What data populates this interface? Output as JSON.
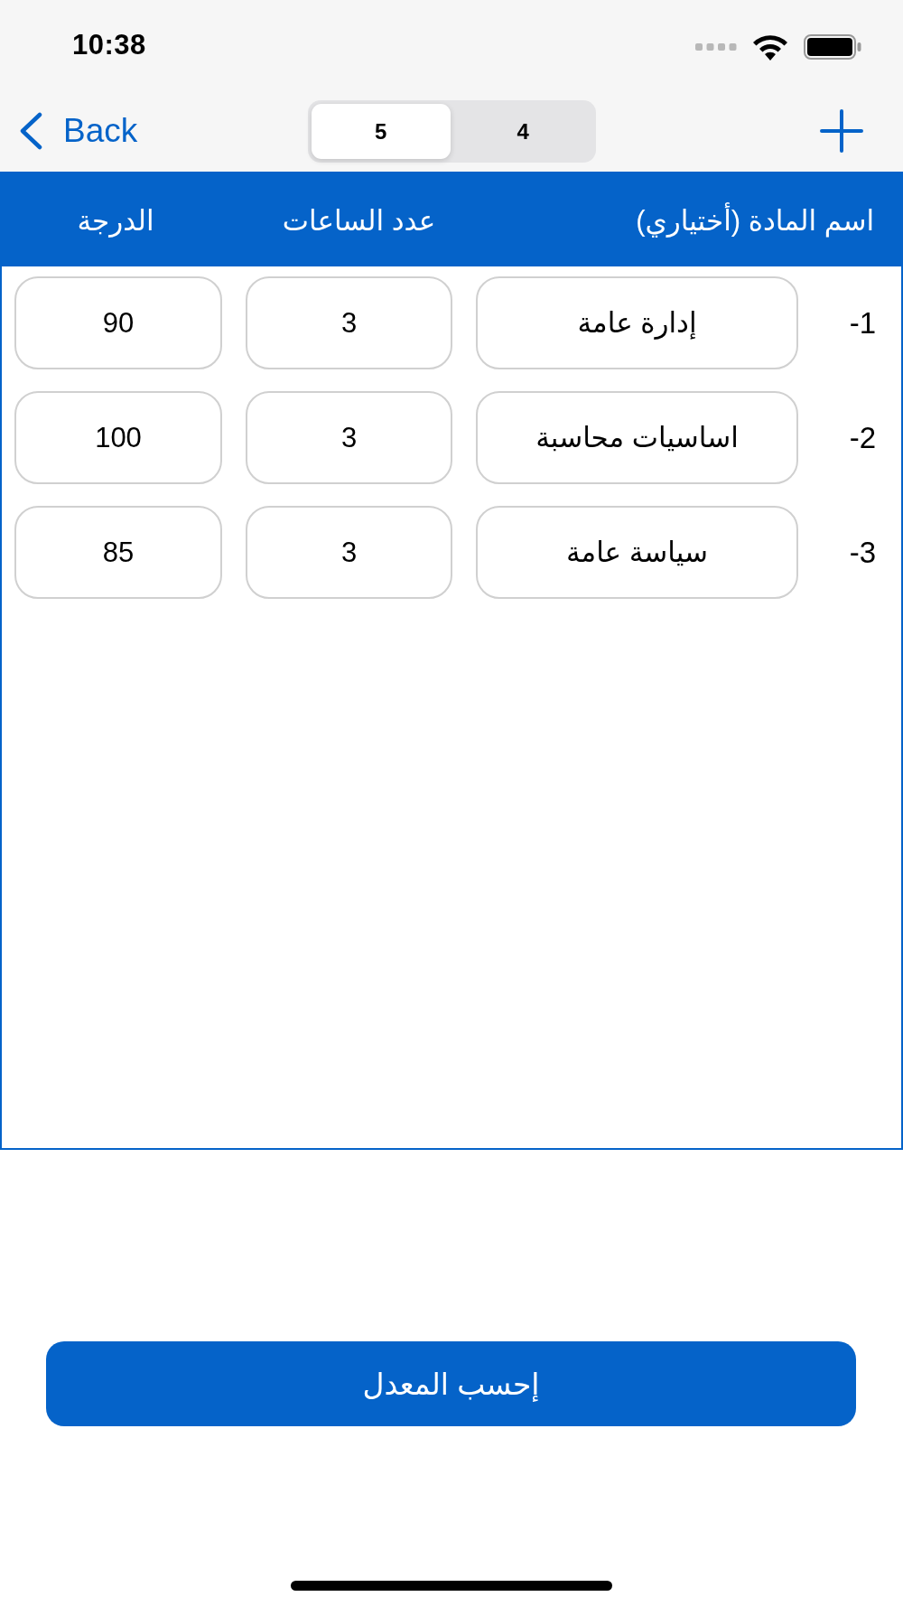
{
  "status_bar": {
    "time": "10:38"
  },
  "nav_bar": {
    "back": "Back",
    "segments": [
      {
        "label": "4",
        "selected": false
      },
      {
        "label": "5",
        "selected": true
      }
    ]
  },
  "table": {
    "columns": [
      "اسم المادة (أختياري)",
      "عدد الساعات",
      "الدرجة"
    ],
    "rows": [
      {
        "number": "-1",
        "name": "إدارة عامة",
        "hours": "3",
        "grade": "90"
      },
      {
        "number": "-2",
        "name": "اساسيات محاسبة",
        "hours": "3",
        "grade": "100"
      },
      {
        "number": "-3",
        "name": "سياسة عامة",
        "hours": "3",
        "grade": "85"
      }
    ]
  },
  "calculate_button": "إحسب المعدل"
}
